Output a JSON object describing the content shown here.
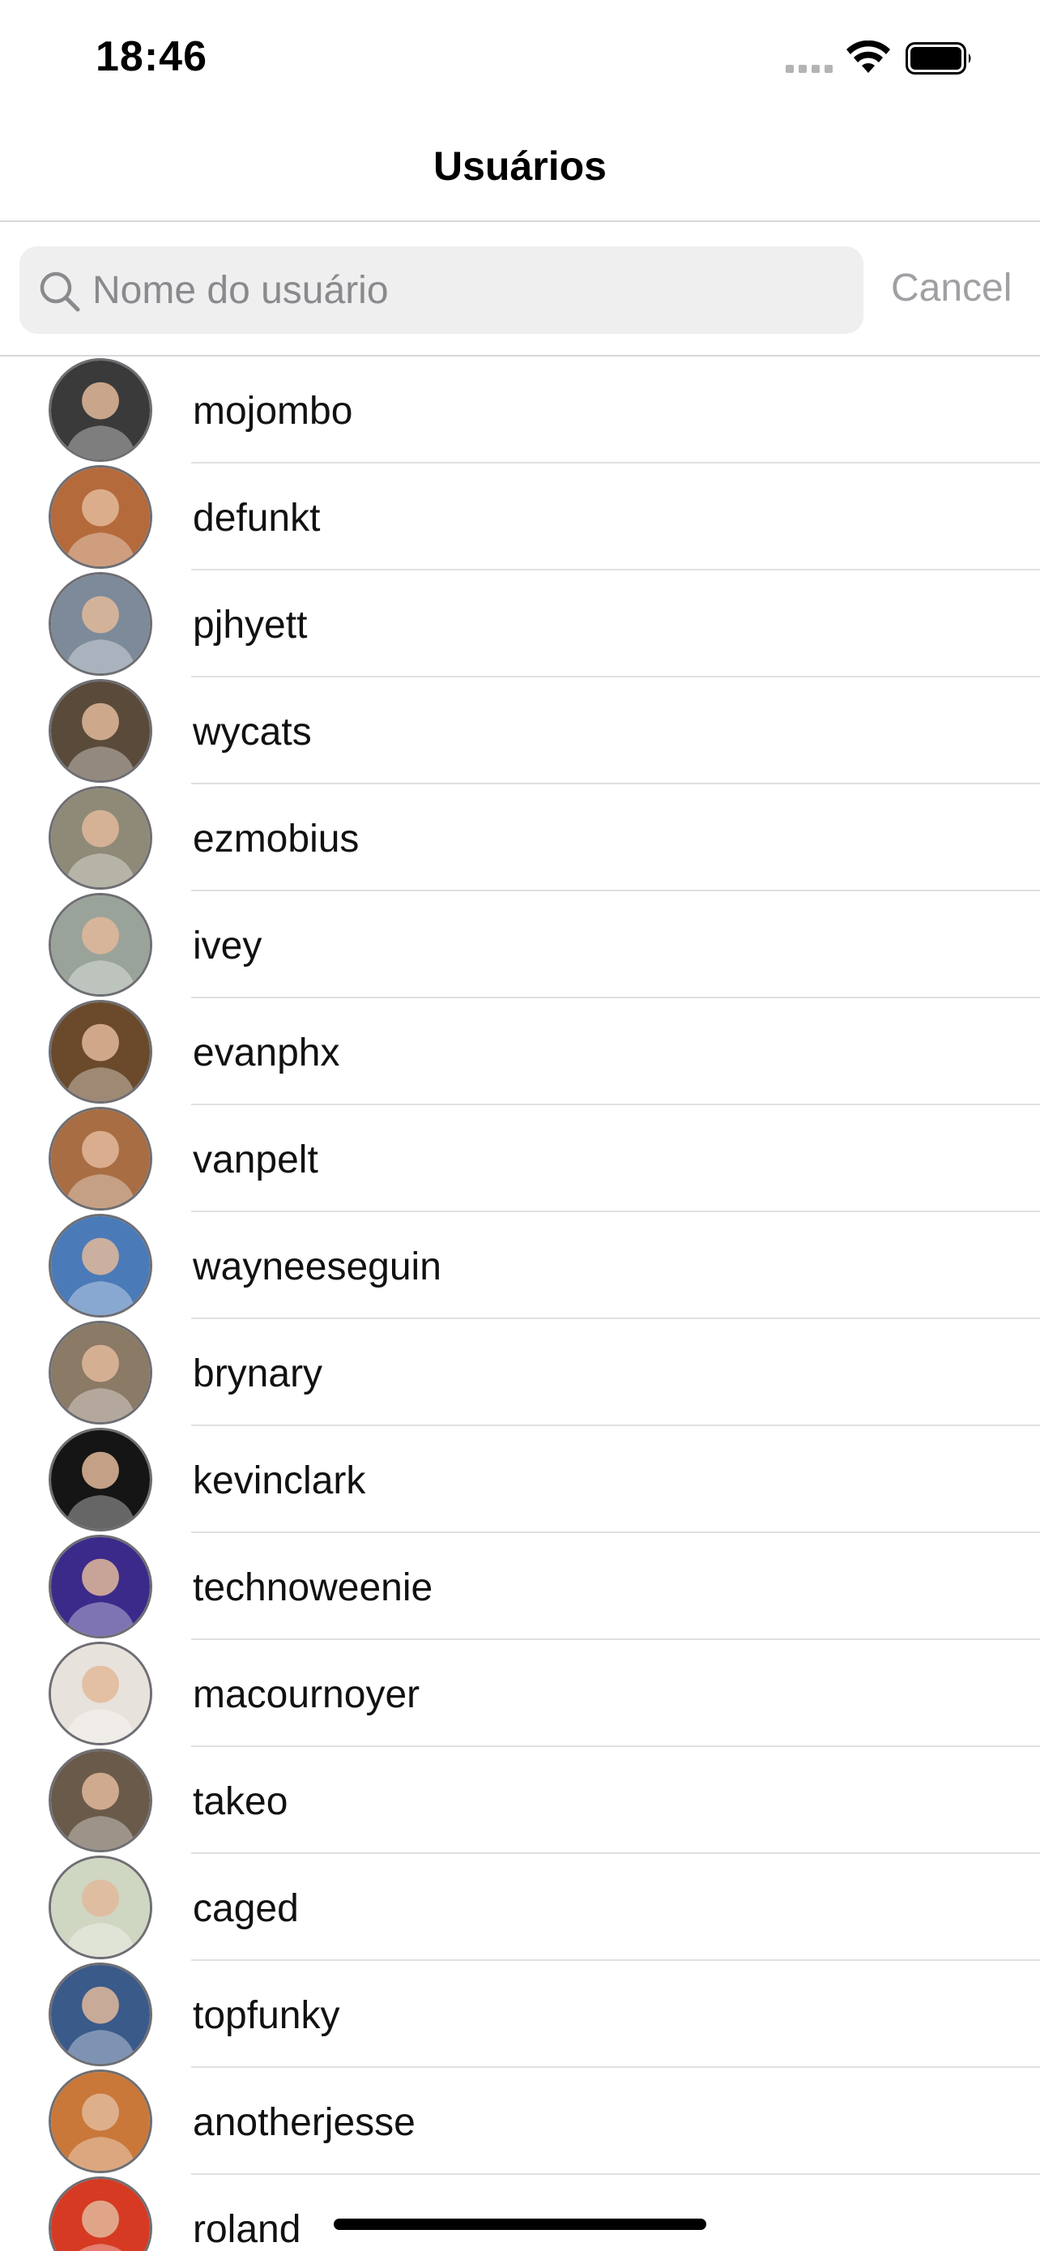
{
  "status_bar": {
    "time": "18:46"
  },
  "nav": {
    "title": "Usuários"
  },
  "search": {
    "placeholder": "Nome do usuário",
    "value": "",
    "cancel_label": "Cancel"
  },
  "users": [
    {
      "login": "mojombo",
      "avatar_color": "#3a3a3a"
    },
    {
      "login": "defunkt",
      "avatar_color": "#b56a3b"
    },
    {
      "login": "pjhyett",
      "avatar_color": "#7d8a9a"
    },
    {
      "login": "wycats",
      "avatar_color": "#5a4a3a"
    },
    {
      "login": "ezmobius",
      "avatar_color": "#8f8a78"
    },
    {
      "login": "ivey",
      "avatar_color": "#9aa39a"
    },
    {
      "login": "evanphx",
      "avatar_color": "#6a4a2a"
    },
    {
      "login": "vanpelt",
      "avatar_color": "#a86d43"
    },
    {
      "login": "wayneeseguin",
      "avatar_color": "#4a7ab8"
    },
    {
      "login": "brynary",
      "avatar_color": "#8a7a66"
    },
    {
      "login": "kevinclark",
      "avatar_color": "#151515"
    },
    {
      "login": "technoweenie",
      "avatar_color": "#3b2a8a"
    },
    {
      "login": "macournoyer",
      "avatar_color": "#e8e2dc"
    },
    {
      "login": "takeo",
      "avatar_color": "#6a5a4a"
    },
    {
      "login": "caged",
      "avatar_color": "#cfd6c2"
    },
    {
      "login": "topfunky",
      "avatar_color": "#3a5a8a"
    },
    {
      "login": "anotherjesse",
      "avatar_color": "#c9783a"
    },
    {
      "login": "roland",
      "avatar_color": "#d63a22"
    }
  ]
}
